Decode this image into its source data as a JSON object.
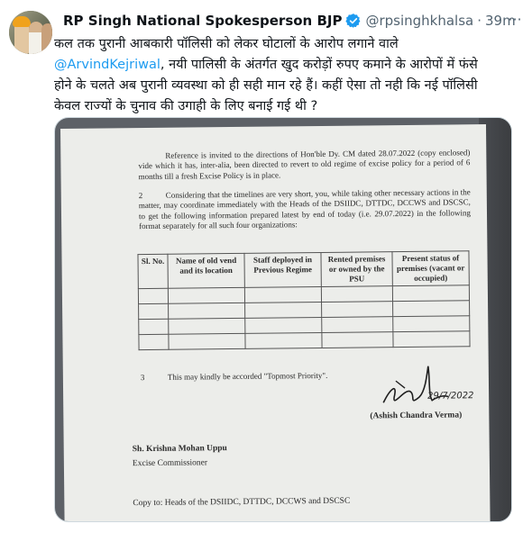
{
  "tweet": {
    "author_name": "RP Singh National Spokesperson BJP",
    "handle": "@rpsinghkhalsa",
    "separator": "·",
    "time": "39m",
    "more_glyph": "···",
    "text_lines": [
      "कल तक पुरानी आबकारी पॉलिसी को लेकर घोटालों के आरोप लगाने वाले",
      "नयी पालिसी के अंतर्गत खुद करोड़ों रुपए कमाने के आरोपों में फंसे",
      "होने के चलते अब पुरानी व्यवस्था को ही सही मान रहे हैं। कहीं ऐसा तो नही कि नई पॉलिसी",
      "केवल राज्यों के चुनाव की उगाही के लिए बनाई गई थी ?"
    ],
    "mention": "@ArvindKejriwal",
    "mention_suffix": ","
  },
  "document": {
    "para1": "Reference is invited to the directions of Hon'ble Dy. CM dated 28.07.2022 (copy enclosed) vide which it has, inter-alia, been directed to revert to old regime of excise policy for a period of 6 months till a fresh Excise Policy is in place.",
    "para2_number": "2",
    "para2": "Considering that the timelines are very short, you, while taking other necessary actions in the matter, may coordinate immediately with the Heads of the DSIIDC, DTTDC, DCCWS and DSCSC, to get the following information prepared latest by end of today (i.e. 29.07.2022) in the following format separately for all such four organizations:",
    "table_headers": [
      "Sl. No.",
      "Name of old vend and its location",
      "Staff deployed in Previous Regime",
      "Rented premises or owned by the PSU",
      "Present status of premises (vacant or occupied)"
    ],
    "para3_number": "3",
    "para3": "This may kindly be accorded \"Topmost Priority\".",
    "signature_date": "29/7/2022",
    "signatory": "(Ashish Chandra Verma)",
    "recipient_name": "Sh. Krishna Mohan Uppu",
    "recipient_title": "Excise Commissioner",
    "copy_to": "Copy to: Heads of the DSIIDC, DTTDC, DCCWS and DSCSC"
  },
  "colors": {
    "link": "#1d9bf0",
    "verified": "#1d9bf0",
    "text": "#0f1419",
    "muted": "#536471"
  }
}
